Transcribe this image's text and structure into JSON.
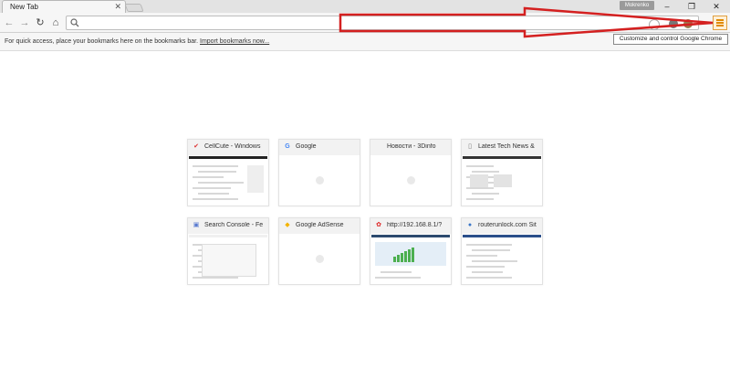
{
  "browser": {
    "tab_title": "New Tab",
    "tab_close": "✕",
    "window_controls": [
      "–",
      "❐",
      "✕"
    ],
    "user_name": "Mokrenko"
  },
  "toolbar": {
    "back": "←",
    "forward": "→",
    "reload": "↻",
    "home": "⌂",
    "omnibox_value": "",
    "menu_icon": "hamburger-menu-icon"
  },
  "bookmarks_bar": {
    "prompt": "For quick access, place your bookmarks here on the bookmarks bar.",
    "import_link": "Import bookmarks now..."
  },
  "tooltip": "Customize and control Google Chrome",
  "annotation": {
    "arrow_color": "#d42020"
  },
  "tiles": [
    {
      "title": "CellCute - Windows",
      "favicon": "cellcute-favicon",
      "fav_char": "✔",
      "fav_color": "#d33"
    },
    {
      "title": "Google",
      "favicon": "google-favicon",
      "fav_char": "G",
      "fav_color": "#4285f4"
    },
    {
      "title": "Новости - 3Dinfo",
      "favicon": "blank-favicon",
      "fav_char": "",
      "fav_color": "#ccc"
    },
    {
      "title": "Latest Tech News &",
      "favicon": "page-favicon",
      "fav_char": "▯",
      "fav_color": "#777"
    },
    {
      "title": "Search Console - Fe",
      "favicon": "search-console-favicon",
      "fav_char": "▣",
      "fav_color": "#5a7bd0"
    },
    {
      "title": "Google AdSense",
      "favicon": "adsense-favicon",
      "fav_char": "◆",
      "fav_color": "#f4b400"
    },
    {
      "title": "http://192.168.8.1/?",
      "favicon": "huawei-favicon",
      "fav_char": "✿",
      "fav_color": "#d22"
    },
    {
      "title": "routerunlock.com Sit",
      "favicon": "routerunlock-favicon",
      "fav_char": "●",
      "fav_color": "#3a76c8"
    }
  ]
}
